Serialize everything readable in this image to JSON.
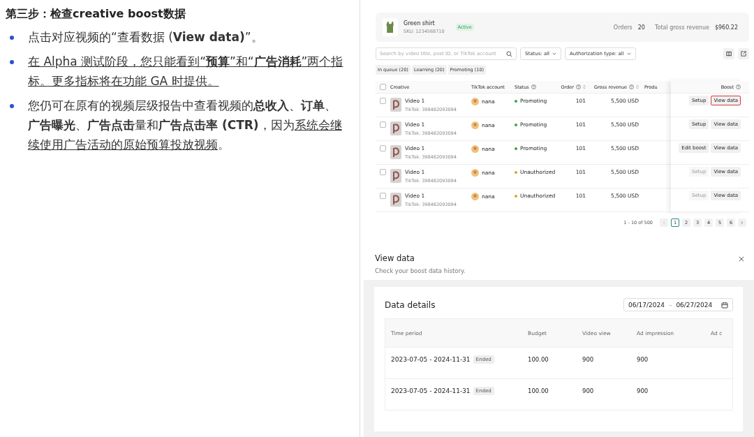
{
  "doc": {
    "title": "第三步：检查creative boost数据",
    "bullets": [
      {
        "segments": [
          {
            "text": "点击对应视频的“查看数据 (**View data)**”。",
            "underline": false
          }
        ]
      },
      {
        "segments": [
          {
            "text": "在 Alpha 测试阶段，您只能看到“**预算**”和“**广告消耗**”两个指标。更多指标将在功能 GA 时提供。",
            "underline": true
          }
        ]
      },
      {
        "segments": [
          {
            "text": "您仍可在原有的视频层级报告中查看视频的**总收入**、**订单**、**广告曝光**、**广告点击**量和**广告点击率 (CTR)**，因为",
            "underline": false
          },
          {
            "text": "系统会继续使用广告活动的原始预算投放视频",
            "underline": true
          },
          {
            "text": "。",
            "underline": false
          }
        ]
      }
    ]
  },
  "product": {
    "name": "Green shirt",
    "sku": "SKU: 1234568710",
    "badge": "Active",
    "orders_label": "Orders",
    "orders": "20",
    "revenue_label": "Total gross revenue",
    "revenue": "$960.22"
  },
  "filters": {
    "search_placeholder": "Search by video title, post ID, or TikTok account",
    "dropdowns": [
      "Status: all",
      "Authorization type: all"
    ]
  },
  "queue_tabs": [
    "In queue (20)",
    "Learning (20)",
    "Promoting (10)"
  ],
  "table": {
    "header_checked": false,
    "columns": [
      "Creative",
      "TikTok account",
      "Status",
      "Order",
      "Gross revenue",
      "Produ",
      "Boost"
    ],
    "rows": [
      {
        "checked": false,
        "title": "Video 1",
        "account_id": "TikTok: 398482093094",
        "account": "nana",
        "status": "Promoting",
        "color": "#2fa84f",
        "order": "101",
        "revenue": "5,500 USD",
        "action": "Setup",
        "action_disabled": false,
        "view": "View data",
        "highlighted": true
      },
      {
        "checked": false,
        "title": "Video 1",
        "account_id": "TikTok: 398482093094",
        "account": "nana",
        "status": "Promoting",
        "color": "#2fa84f",
        "order": "101",
        "revenue": "5,500 USD",
        "action": "Setup",
        "action_disabled": false,
        "view": "View data",
        "highlighted": false
      },
      {
        "checked": false,
        "title": "Video 1",
        "account_id": "TikTok: 398482093094",
        "account": "nana",
        "status": "Promoting",
        "color": "#2fa84f",
        "order": "101",
        "revenue": "5,500 USD",
        "action": "Edit boost",
        "action_disabled": false,
        "view": "View data",
        "highlighted": false
      },
      {
        "checked": false,
        "title": "Video 1",
        "account_id": "TikTok: 398482093094",
        "account": "nana",
        "status": "Unauthorized",
        "color": "#e0a526",
        "order": "101",
        "revenue": "5,500 USD",
        "action": "Setup",
        "action_disabled": true,
        "view": "View data",
        "highlighted": false
      },
      {
        "checked": false,
        "title": "Video 1",
        "account_id": "TikTok: 398482093094",
        "account": "nana",
        "status": "Unauthorized",
        "color": "#e0a526",
        "order": "101",
        "revenue": "5,500 USD",
        "action": "Setup",
        "action_disabled": true,
        "view": "View data",
        "highlighted": false
      }
    ]
  },
  "pagination": {
    "range": "1 - 10 of 500",
    "pages": [
      {
        "label": "1",
        "selected": true
      },
      {
        "label": "2",
        "selected": false
      },
      {
        "label": "3",
        "selected": false
      },
      {
        "label": "4",
        "selected": false
      },
      {
        "label": "5",
        "selected": false
      },
      {
        "label": "6",
        "selected": false
      }
    ]
  },
  "modal": {
    "title": "View data",
    "subtitle": "Check your boost data history.",
    "section_title": "Data details",
    "date_from": "06/17/2024",
    "date_sep": "–",
    "date_to": "06/27/2024",
    "columns": [
      "Time period",
      "Budget",
      "Video view",
      "Ad impression",
      "Ad c"
    ],
    "rows": [
      {
        "period": "2023-07-05 - 2024-11-31",
        "tag": "Ended",
        "budget": "100.00",
        "views": "900",
        "impressions": "900"
      },
      {
        "period": "2023-07-05 - 2024-11-31",
        "tag": "Ended",
        "budget": "100.00",
        "views": "900",
        "impressions": "900"
      }
    ]
  }
}
